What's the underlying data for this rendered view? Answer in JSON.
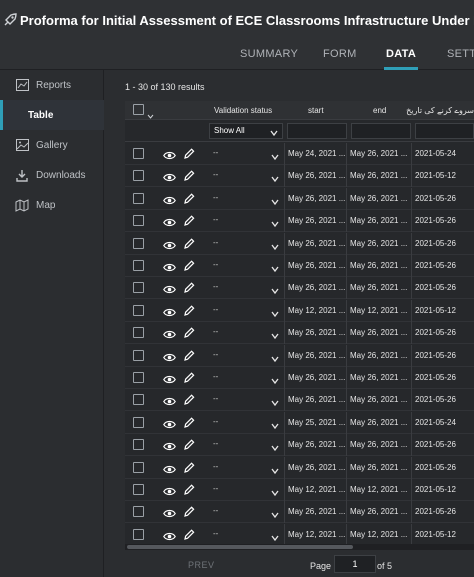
{
  "header": {
    "title": "Proforma for Initial Assessment of ECE Classrooms Infrastructure Under PHCIP Project"
  },
  "tabs": [
    {
      "label": "SUMMARY"
    },
    {
      "label": "FORM"
    },
    {
      "label": "DATA"
    },
    {
      "label": "SETTI"
    }
  ],
  "sidebar": {
    "items": [
      {
        "label": "Reports",
        "icon": "reports-icon"
      },
      {
        "label": "Table",
        "icon": "table-icon"
      },
      {
        "label": "Gallery",
        "icon": "gallery-icon"
      },
      {
        "label": "Downloads",
        "icon": "download-icon"
      },
      {
        "label": "Map",
        "icon": "map-icon"
      }
    ]
  },
  "table": {
    "results_text": "1 - 30 of 130 results",
    "columns": {
      "validation": "Validation status",
      "start": "start",
      "end": "end",
      "survey_date": "سروے کرنے کی تاریخ"
    },
    "filter": {
      "validation_selected": "Show All"
    },
    "rows": [
      {
        "validation": "--",
        "start": "May 24, 2021 ...",
        "end": "May 26, 2021 ...",
        "date": "2021-05-24"
      },
      {
        "validation": "--",
        "start": "May 26, 2021 ...",
        "end": "May 26, 2021 ...",
        "date": "2021-05-12"
      },
      {
        "validation": "--",
        "start": "May 26, 2021 ...",
        "end": "May 26, 2021 ...",
        "date": "2021-05-26"
      },
      {
        "validation": "--",
        "start": "May 26, 2021 ...",
        "end": "May 26, 2021 ...",
        "date": "2021-05-26"
      },
      {
        "validation": "--",
        "start": "May 26, 2021 ...",
        "end": "May 26, 2021 ...",
        "date": "2021-05-26"
      },
      {
        "validation": "--",
        "start": "May 26, 2021 ...",
        "end": "May 26, 2021 ...",
        "date": "2021-05-26"
      },
      {
        "validation": "--",
        "start": "May 26, 2021 ...",
        "end": "May 26, 2021 ...",
        "date": "2021-05-26"
      },
      {
        "validation": "--",
        "start": "May 12, 2021 ...",
        "end": "May 12, 2021 ...",
        "date": "2021-05-12"
      },
      {
        "validation": "--",
        "start": "May 26, 2021 ...",
        "end": "May 26, 2021 ...",
        "date": "2021-05-26"
      },
      {
        "validation": "--",
        "start": "May 26, 2021 ...",
        "end": "May 26, 2021 ...",
        "date": "2021-05-26"
      },
      {
        "validation": "--",
        "start": "May 26, 2021 ...",
        "end": "May 26, 2021 ...",
        "date": "2021-05-26"
      },
      {
        "validation": "--",
        "start": "May 26, 2021 ...",
        "end": "May 26, 2021 ...",
        "date": "2021-05-26"
      },
      {
        "validation": "--",
        "start": "May 25, 2021 ...",
        "end": "May 26, 2021 ...",
        "date": "2021-05-24"
      },
      {
        "validation": "--",
        "start": "May 26, 2021 ...",
        "end": "May 26, 2021 ...",
        "date": "2021-05-26"
      },
      {
        "validation": "--",
        "start": "May 26, 2021 ...",
        "end": "May 26, 2021 ...",
        "date": "2021-05-26"
      },
      {
        "validation": "--",
        "start": "May 12, 2021 ...",
        "end": "May 12, 2021 ...",
        "date": "2021-05-12"
      },
      {
        "validation": "--",
        "start": "May 26, 2021 ...",
        "end": "May 26, 2021 ...",
        "date": "2021-05-26"
      },
      {
        "validation": "--",
        "start": "May 12, 2021 ...",
        "end": "May 12, 2021 ...",
        "date": "2021-05-12"
      }
    ]
  },
  "pagination": {
    "prev_label": "PREV",
    "page_label": "Page",
    "page_value": "1",
    "of_label": "of 5"
  },
  "colors": {
    "accent": "#2f9fb8",
    "background": "#2b2d30",
    "panel": "#26282b"
  }
}
